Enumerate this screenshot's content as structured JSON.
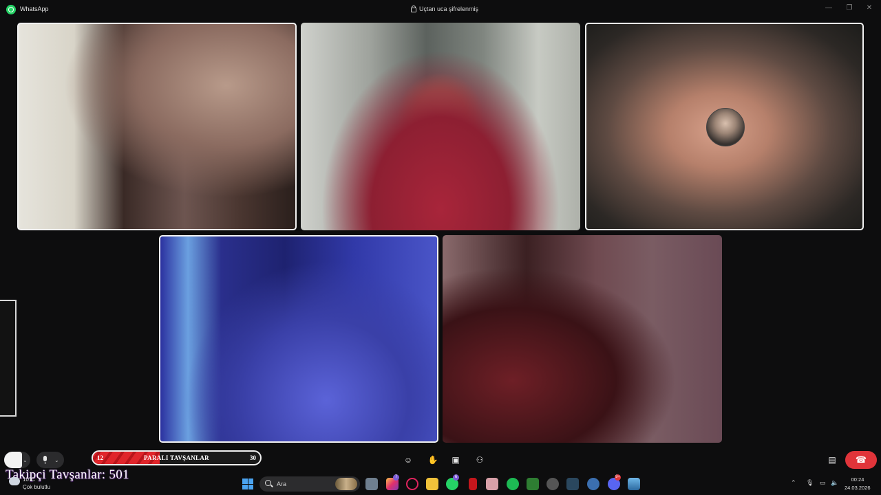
{
  "window": {
    "app_name": "WhatsApp",
    "encryption_label": "Uçtan uca şifrelenmiş",
    "minimize_glyph": "—",
    "maximize_glyph": "❐",
    "close_glyph": "✕"
  },
  "participants": [
    {
      "id": "p1",
      "selected": true
    },
    {
      "id": "p2",
      "selected": false
    },
    {
      "id": "p3",
      "selected": true,
      "shows_avatar": true
    },
    {
      "id": "p4",
      "selected": true
    },
    {
      "id": "p5",
      "selected": false
    }
  ],
  "overlay": {
    "progress": {
      "label": "PARALI TAVŞANLAR",
      "current": "12",
      "goal": "30",
      "fraction": 0.4
    },
    "followers_text": "Takipçi Tavşanlar: 501"
  },
  "call_controls": {
    "icons": [
      "emoji-icon",
      "raise-hand-icon",
      "share-screen-icon",
      "add-people-icon",
      "layout-icon",
      "end-call-icon"
    ]
  },
  "taskbar": {
    "weather_temp": "10°C",
    "weather_desc": "Çok bulutlu",
    "search_placeholder": "Ara",
    "instagram_badge": "7",
    "whatsapp_badge": "6",
    "discord_badge": "9+",
    "time": "00:24",
    "date": "24.03.2026"
  },
  "colors": {
    "background": "#0d0d0e",
    "whatsapp_green": "#25d366",
    "end_call_red": "#e0343a",
    "progress_red": "#e0252b"
  }
}
